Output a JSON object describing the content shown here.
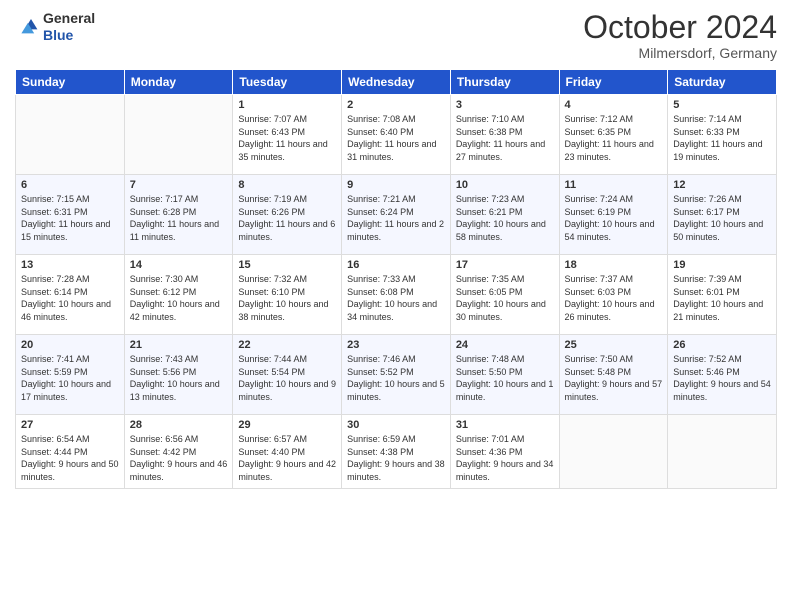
{
  "header": {
    "logo_line1": "General",
    "logo_line2": "Blue",
    "month": "October 2024",
    "location": "Milmersdorf, Germany"
  },
  "days_of_week": [
    "Sunday",
    "Monday",
    "Tuesday",
    "Wednesday",
    "Thursday",
    "Friday",
    "Saturday"
  ],
  "weeks": [
    [
      {
        "day": "",
        "info": ""
      },
      {
        "day": "",
        "info": ""
      },
      {
        "day": "1",
        "info": "Sunrise: 7:07 AM\nSunset: 6:43 PM\nDaylight: 11 hours and 35 minutes."
      },
      {
        "day": "2",
        "info": "Sunrise: 7:08 AM\nSunset: 6:40 PM\nDaylight: 11 hours and 31 minutes."
      },
      {
        "day": "3",
        "info": "Sunrise: 7:10 AM\nSunset: 6:38 PM\nDaylight: 11 hours and 27 minutes."
      },
      {
        "day": "4",
        "info": "Sunrise: 7:12 AM\nSunset: 6:35 PM\nDaylight: 11 hours and 23 minutes."
      },
      {
        "day": "5",
        "info": "Sunrise: 7:14 AM\nSunset: 6:33 PM\nDaylight: 11 hours and 19 minutes."
      }
    ],
    [
      {
        "day": "6",
        "info": "Sunrise: 7:15 AM\nSunset: 6:31 PM\nDaylight: 11 hours and 15 minutes."
      },
      {
        "day": "7",
        "info": "Sunrise: 7:17 AM\nSunset: 6:28 PM\nDaylight: 11 hours and 11 minutes."
      },
      {
        "day": "8",
        "info": "Sunrise: 7:19 AM\nSunset: 6:26 PM\nDaylight: 11 hours and 6 minutes."
      },
      {
        "day": "9",
        "info": "Sunrise: 7:21 AM\nSunset: 6:24 PM\nDaylight: 11 hours and 2 minutes."
      },
      {
        "day": "10",
        "info": "Sunrise: 7:23 AM\nSunset: 6:21 PM\nDaylight: 10 hours and 58 minutes."
      },
      {
        "day": "11",
        "info": "Sunrise: 7:24 AM\nSunset: 6:19 PM\nDaylight: 10 hours and 54 minutes."
      },
      {
        "day": "12",
        "info": "Sunrise: 7:26 AM\nSunset: 6:17 PM\nDaylight: 10 hours and 50 minutes."
      }
    ],
    [
      {
        "day": "13",
        "info": "Sunrise: 7:28 AM\nSunset: 6:14 PM\nDaylight: 10 hours and 46 minutes."
      },
      {
        "day": "14",
        "info": "Sunrise: 7:30 AM\nSunset: 6:12 PM\nDaylight: 10 hours and 42 minutes."
      },
      {
        "day": "15",
        "info": "Sunrise: 7:32 AM\nSunset: 6:10 PM\nDaylight: 10 hours and 38 minutes."
      },
      {
        "day": "16",
        "info": "Sunrise: 7:33 AM\nSunset: 6:08 PM\nDaylight: 10 hours and 34 minutes."
      },
      {
        "day": "17",
        "info": "Sunrise: 7:35 AM\nSunset: 6:05 PM\nDaylight: 10 hours and 30 minutes."
      },
      {
        "day": "18",
        "info": "Sunrise: 7:37 AM\nSunset: 6:03 PM\nDaylight: 10 hours and 26 minutes."
      },
      {
        "day": "19",
        "info": "Sunrise: 7:39 AM\nSunset: 6:01 PM\nDaylight: 10 hours and 21 minutes."
      }
    ],
    [
      {
        "day": "20",
        "info": "Sunrise: 7:41 AM\nSunset: 5:59 PM\nDaylight: 10 hours and 17 minutes."
      },
      {
        "day": "21",
        "info": "Sunrise: 7:43 AM\nSunset: 5:56 PM\nDaylight: 10 hours and 13 minutes."
      },
      {
        "day": "22",
        "info": "Sunrise: 7:44 AM\nSunset: 5:54 PM\nDaylight: 10 hours and 9 minutes."
      },
      {
        "day": "23",
        "info": "Sunrise: 7:46 AM\nSunset: 5:52 PM\nDaylight: 10 hours and 5 minutes."
      },
      {
        "day": "24",
        "info": "Sunrise: 7:48 AM\nSunset: 5:50 PM\nDaylight: 10 hours and 1 minute."
      },
      {
        "day": "25",
        "info": "Sunrise: 7:50 AM\nSunset: 5:48 PM\nDaylight: 9 hours and 57 minutes."
      },
      {
        "day": "26",
        "info": "Sunrise: 7:52 AM\nSunset: 5:46 PM\nDaylight: 9 hours and 54 minutes."
      }
    ],
    [
      {
        "day": "27",
        "info": "Sunrise: 6:54 AM\nSunset: 4:44 PM\nDaylight: 9 hours and 50 minutes."
      },
      {
        "day": "28",
        "info": "Sunrise: 6:56 AM\nSunset: 4:42 PM\nDaylight: 9 hours and 46 minutes."
      },
      {
        "day": "29",
        "info": "Sunrise: 6:57 AM\nSunset: 4:40 PM\nDaylight: 9 hours and 42 minutes."
      },
      {
        "day": "30",
        "info": "Sunrise: 6:59 AM\nSunset: 4:38 PM\nDaylight: 9 hours and 38 minutes."
      },
      {
        "day": "31",
        "info": "Sunrise: 7:01 AM\nSunset: 4:36 PM\nDaylight: 9 hours and 34 minutes."
      },
      {
        "day": "",
        "info": ""
      },
      {
        "day": "",
        "info": ""
      }
    ]
  ]
}
